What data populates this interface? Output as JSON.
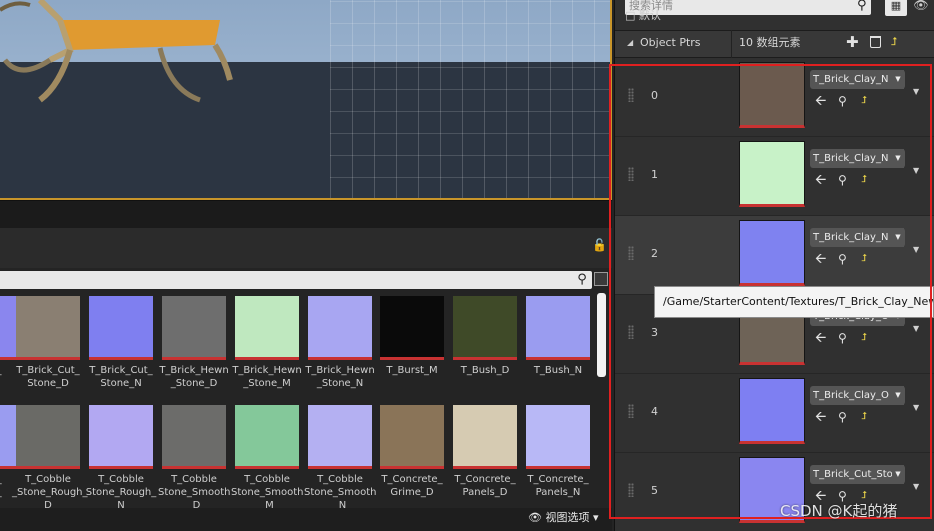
{
  "details": {
    "search_placeholder": "搜索详情",
    "category_label": "□ 默认",
    "property": {
      "name": "Object Ptrs",
      "array_count": "10 数组元素"
    },
    "elements": [
      {
        "index": "0",
        "asset": "T_Brick_Clay_N",
        "color": "#6b5a4e"
      },
      {
        "index": "1",
        "asset": "T_Brick_Clay_N",
        "color": "#c8f2c8"
      },
      {
        "index": "2",
        "asset": "T_Brick_Clay_N",
        "color": "#7f82f0"
      },
      {
        "index": "3",
        "asset": "T_Brick_Clay_O",
        "color": "#6e6357"
      },
      {
        "index": "4",
        "asset": "T_Brick_Clay_O",
        "color": "#7e7ff2"
      },
      {
        "index": "5",
        "asset": "T_Brick_Cut_Sto",
        "color": "#8a86f0"
      }
    ],
    "tooltip": "/Game/StarterContent/Textures/T_Brick_Clay_New_"
  },
  "content_browser": {
    "view_options_label": "视图选项",
    "row1": [
      {
        "label": "y_",
        "color": "#8a86ee"
      },
      {
        "label": "T_Brick_Cut_\nStone_D",
        "color": "#8a7f72"
      },
      {
        "label": "T_Brick_Cut_\nStone_N",
        "color": "#7f7ff0"
      },
      {
        "label": "T_Brick_Hewn\n_Stone_D",
        "color": "#6e6e6e"
      },
      {
        "label": "T_Brick_Hewn\n_Stone_M",
        "color": "#bfe8bf"
      },
      {
        "label": "T_Brick_Hewn\n_Stone_N",
        "color": "#a8a6f2"
      },
      {
        "label": "T_Burst_M",
        "color": "#0a0a0a"
      },
      {
        "label": "T_Bush_D",
        "color": "#3f4a28"
      },
      {
        "label": "T_Bush_N",
        "color": "#9a9cf0"
      }
    ],
    "row2": [
      {
        "label": "e_\nh_",
        "color": "#9a9cf0"
      },
      {
        "label": "T_Cobble\n_Stone_Rough_\nD",
        "color": "#6a6a66"
      },
      {
        "label": "T_Cobble\nStone_Rough_\nN",
        "color": "#b2a8f2"
      },
      {
        "label": "T_Cobble\nStone_Smooth\n_D",
        "color": "#6c6c6a"
      },
      {
        "label": "T_Cobble\nStone_Smooth\n_M",
        "color": "#84c89a"
      },
      {
        "label": "T_Cobble\nStone_Smooth\n_N",
        "color": "#b4b0f2"
      },
      {
        "label": "T_Concrete_\nGrime_D",
        "color": "#8a7458"
      },
      {
        "label": "T_Concrete_\nPanels_D",
        "color": "#d6cbb2"
      },
      {
        "label": "T_Concrete_\nPanels_N",
        "color": "#b8b8f6"
      }
    ]
  },
  "watermark": "CSDN @K起的猪",
  "colors": {
    "accent_highlight": "#e02020",
    "link_bar": "#c83232",
    "reset_arrow": "#e8d24a"
  }
}
